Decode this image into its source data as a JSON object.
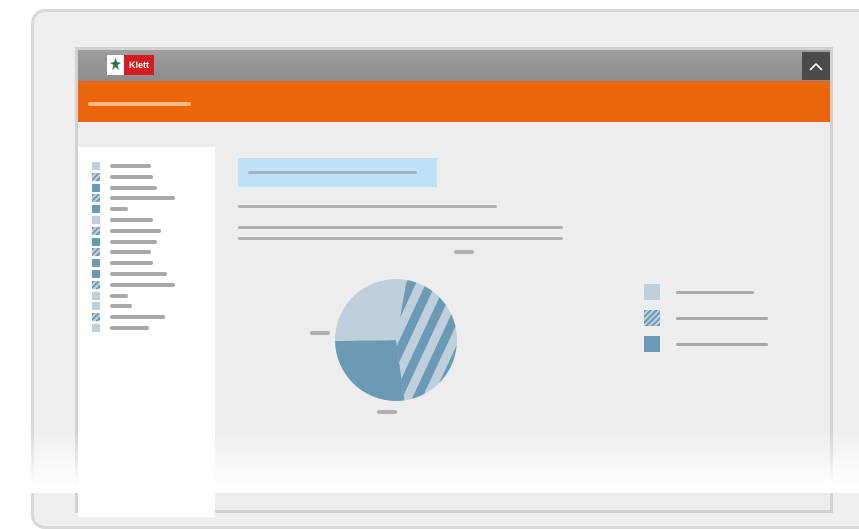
{
  "brand": {
    "logo_text": "Klett",
    "logo_color": "#d71920"
  },
  "colors": {
    "header": "#ec6508",
    "titlebar": "#969696",
    "swatch_light": "#c0cfdc",
    "swatch_dark": "#6b9ab5",
    "heading_highlight": "#bfe1f7"
  },
  "icons": {
    "collapse": "chevron-up-icon",
    "emblem": "lily-emblem-icon"
  },
  "sidebar": {
    "items": [
      {
        "swatch": "light"
      },
      {
        "swatch": "striped"
      },
      {
        "swatch": "dark"
      },
      {
        "swatch": "striped"
      },
      {
        "swatch": "dark"
      },
      {
        "swatch": "light"
      },
      {
        "swatch": "striped"
      },
      {
        "swatch": "dark"
      },
      {
        "swatch": "striped"
      },
      {
        "swatch": "dark"
      },
      {
        "swatch": "dark"
      },
      {
        "swatch": "striped"
      },
      {
        "swatch": "light"
      },
      {
        "swatch": "light"
      },
      {
        "swatch": "striped"
      },
      {
        "swatch": "light"
      }
    ]
  },
  "chart_data": {
    "type": "pie",
    "slices": [
      {
        "fill": "striped",
        "value": 45
      },
      {
        "fill": "dark",
        "value": 27
      },
      {
        "fill": "light",
        "value": 28
      }
    ],
    "labels_shown_as_placeholders": true,
    "legend": [
      {
        "fill": "light"
      },
      {
        "fill": "striped"
      },
      {
        "fill": "dark"
      }
    ],
    "legend_placement": "right"
  }
}
